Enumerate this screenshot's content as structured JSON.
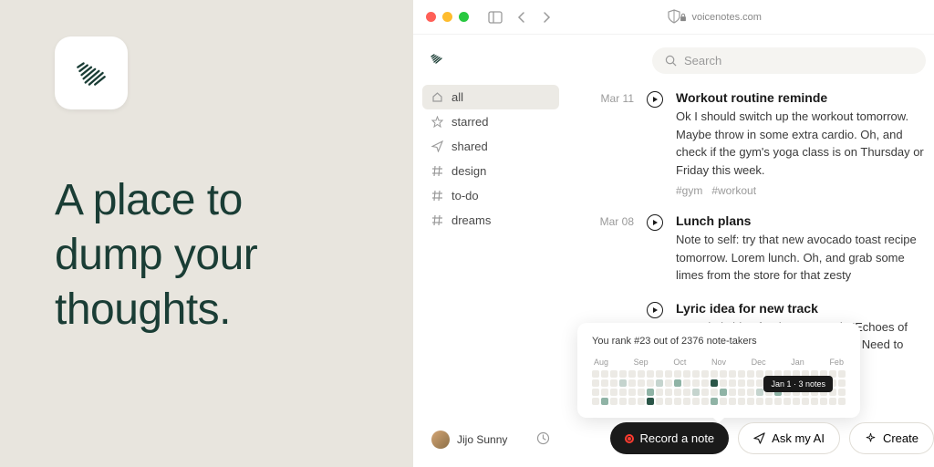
{
  "hero": {
    "tagline": "A place to dump your thoughts."
  },
  "browser": {
    "url": "voicenotes.com"
  },
  "sidebar": {
    "items": [
      {
        "icon": "home",
        "label": "all",
        "active": true
      },
      {
        "icon": "star",
        "label": "starred"
      },
      {
        "icon": "send",
        "label": "shared"
      },
      {
        "icon": "hash",
        "label": "design"
      },
      {
        "icon": "hash",
        "label": "to-do"
      },
      {
        "icon": "hash",
        "label": "dreams"
      }
    ],
    "user": "Jijo Sunny"
  },
  "search": {
    "placeholder": "Search"
  },
  "notes": [
    {
      "date": "Mar 11",
      "title": "Workout routine reminde",
      "body": "Ok I should switch up the workout tomorrow. Maybe throw in some extra cardio. Oh, and check if the gym's yoga class is on Thursday or Friday this week.",
      "tags": [
        "#gym",
        "#workout"
      ]
    },
    {
      "date": "Mar 08",
      "title": "Lunch plans",
      "body": "Note to self: try that new avocado toast recipe tomorrow. Lorem lunch. Oh, and grab some limes from the store for that zesty",
      "tags": []
    },
    {
      "date": "",
      "title": "Lyric idea for new track",
      "body": "Got a lyric idea for the new track: 'Echoes of laughter in the work for the chorus. Need to match it with some chords late",
      "tags": []
    }
  ],
  "rank": {
    "text": "You rank #23 out of 2376 note-takers",
    "months": [
      "Aug",
      "Sep",
      "Oct",
      "Nov",
      "Dec",
      "Jan",
      "Feb"
    ],
    "tooltip": "Jan 1 · 3 notes",
    "cells": [
      0,
      0,
      0,
      0,
      0,
      0,
      0,
      0,
      0,
      0,
      0,
      0,
      0,
      0,
      0,
      0,
      0,
      0,
      0,
      0,
      0,
      0,
      0,
      0,
      0,
      0,
      0,
      0,
      0,
      0,
      0,
      1,
      0,
      0,
      0,
      1,
      0,
      2,
      0,
      0,
      0,
      3,
      0,
      0,
      0,
      0,
      0,
      0,
      1,
      0,
      0,
      0,
      0,
      0,
      0,
      0,
      0,
      0,
      0,
      0,
      0,
      0,
      2,
      0,
      0,
      0,
      0,
      1,
      0,
      0,
      2,
      0,
      0,
      0,
      1,
      0,
      2,
      0,
      0,
      0,
      0,
      0,
      0,
      0,
      0,
      2,
      0,
      0,
      0,
      0,
      3,
      0,
      0,
      0,
      0,
      0,
      0,
      2,
      0,
      0,
      0,
      0,
      0,
      0,
      0,
      0,
      0,
      0,
      0,
      0,
      0,
      0
    ]
  },
  "actions": {
    "record": "Record a note",
    "ask": "Ask my AI",
    "create": "Create"
  }
}
